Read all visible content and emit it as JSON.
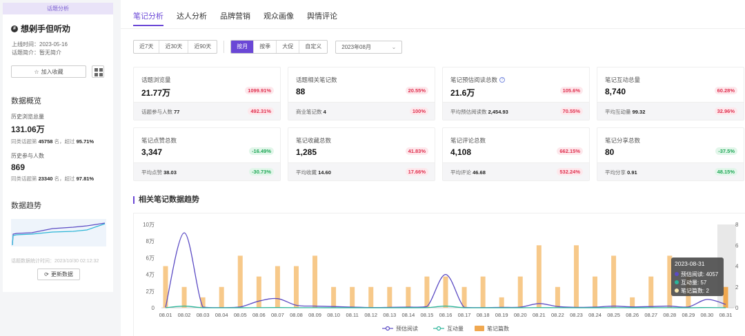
{
  "left": {
    "tag": "话题分析",
    "topic_name": "想剁手但听劝",
    "online_time": "上线时间：2023-05-16",
    "intro": "话题简介：暂无简介",
    "fav_label": "加入收藏",
    "overview_title": "数据概览",
    "history_views_label": "历史浏览总量",
    "history_views_value": "131.06万",
    "history_views_rank_prefix": "同类话题第",
    "history_views_rank": "45758",
    "history_views_beat_prefix": "名，超过",
    "history_views_beat": "95.71%",
    "history_users_label": "历史参与人数",
    "history_users_value": "869",
    "history_users_rank_prefix": "同类话题第",
    "history_users_rank": "23340",
    "history_users_beat_prefix": "名，超过",
    "history_users_beat": "97.81%",
    "trend_title": "数据趋势",
    "update_time": "话题数据统计时间：2023/10/30 02:12:32",
    "refresh_label": "更新数据"
  },
  "tabs": [
    "笔记分析",
    "达人分析",
    "品牌营销",
    "观众画像",
    "舆情评论"
  ],
  "filters": {
    "range": [
      "近7天",
      "近30天",
      "近90天"
    ],
    "period": [
      "按月",
      "按季",
      "大促",
      "自定义"
    ],
    "month": "2023年08月"
  },
  "cards": [
    {
      "label": "话题浏览量",
      "value": "21.77万",
      "badge": "1099.91%",
      "dir": "up",
      "sub_label": "话题参与人数",
      "sub_value": "77",
      "sub_badge": "492.31%",
      "sub_dir": "up"
    },
    {
      "label": "话题相关笔记数",
      "value": "88",
      "badge": "20.55%",
      "dir": "up",
      "sub_label": "商业笔记数",
      "sub_value": "4",
      "sub_badge": "100%",
      "sub_dir": "up"
    },
    {
      "label": "笔记预估阅读总数",
      "value": "21.6万",
      "badge": "105.6%",
      "dir": "up",
      "sub_label": "平均预估阅读数",
      "sub_value": "2,454.93",
      "sub_badge": "70.55%",
      "sub_dir": "up",
      "help": true
    },
    {
      "label": "笔记互动总量",
      "value": "8,740",
      "badge": "60.28%",
      "dir": "up",
      "sub_label": "平均互动量",
      "sub_value": "99.32",
      "sub_badge": "32.96%",
      "sub_dir": "up"
    },
    {
      "label": "笔记点赞总数",
      "value": "3,347",
      "badge": "-16.49%",
      "dir": "down",
      "sub_label": "平均点赞",
      "sub_value": "38.03",
      "sub_badge": "-30.73%",
      "sub_dir": "down"
    },
    {
      "label": "笔记收藏总数",
      "value": "1,285",
      "badge": "41.83%",
      "dir": "up",
      "sub_label": "平均收藏",
      "sub_value": "14.60",
      "sub_badge": "17.66%",
      "sub_dir": "up"
    },
    {
      "label": "笔记评论总数",
      "value": "4,108",
      "badge": "662.15%",
      "dir": "up",
      "sub_label": "平均评论",
      "sub_value": "46.68",
      "sub_badge": "532.24%",
      "sub_dir": "up"
    },
    {
      "label": "笔记分享总数",
      "value": "80",
      "badge": "-37.5%",
      "dir": "down",
      "sub_label": "平均分享",
      "sub_value": "0.91",
      "sub_badge": "48.15%",
      "sub_dir": "down"
    }
  ],
  "chart_title": "相关笔记数据趋势",
  "chart_data": {
    "type": "line",
    "categories": [
      "08.01",
      "08.02",
      "08.03",
      "08.04",
      "08.05",
      "08.06",
      "08.07",
      "08.08",
      "08.09",
      "08.10",
      "08.11",
      "08.12",
      "08.13",
      "08.14",
      "08.15",
      "08.16",
      "08.17",
      "08.18",
      "08.19",
      "08.20",
      "08.21",
      "08.22",
      "08.23",
      "08.24",
      "08.25",
      "08.26",
      "08.27",
      "08.28",
      "08.29",
      "08.30",
      "08.31"
    ],
    "y_left_ticks": [
      "0",
      "2万",
      "4万",
      "6万",
      "8万",
      "10万"
    ],
    "y_left_max": 100000,
    "y_right_ticks": [
      "0",
      "2",
      "4",
      "6",
      "8"
    ],
    "y_right_max": 8,
    "series": [
      {
        "name": "预估阅读",
        "axis": "left",
        "kind": "line",
        "color": "#5b4bc4",
        "values": [
          500,
          90000,
          800,
          200,
          1000,
          8000,
          11000,
          3000,
          2000,
          1500,
          800,
          300,
          500,
          800,
          1500,
          40000,
          500,
          200,
          500,
          800,
          5000,
          1500,
          500,
          800,
          2000,
          1000,
          1500,
          2000,
          1000,
          10000,
          4057
        ]
      },
      {
        "name": "互动量",
        "axis": "left",
        "kind": "line",
        "color": "#2bb59a",
        "values": [
          50,
          2000,
          30,
          20,
          50,
          200,
          300,
          100,
          80,
          60,
          40,
          20,
          30,
          40,
          80,
          2000,
          30,
          20,
          30,
          40,
          200,
          80,
          30,
          40,
          100,
          50,
          80,
          100,
          50,
          300,
          57
        ]
      },
      {
        "name": "笔记篇数",
        "axis": "right",
        "kind": "bar",
        "color": "#f7c98a",
        "values": [
          4,
          2,
          1,
          2,
          5,
          3,
          4,
          4,
          5,
          2,
          2,
          2,
          2,
          2,
          3,
          3,
          2,
          3,
          1,
          3,
          6,
          2,
          6,
          3,
          5,
          1,
          3,
          5,
          3,
          0,
          2
        ]
      }
    ],
    "tooltip": {
      "date": "2023-08-31",
      "lines": [
        "预估阅读: 4057",
        "互动量: 57",
        "笔记篇数: 2"
      ]
    },
    "legend": [
      "预估阅读",
      "互动量",
      "笔记篇数"
    ],
    "legend_placement": "bottom-center"
  }
}
